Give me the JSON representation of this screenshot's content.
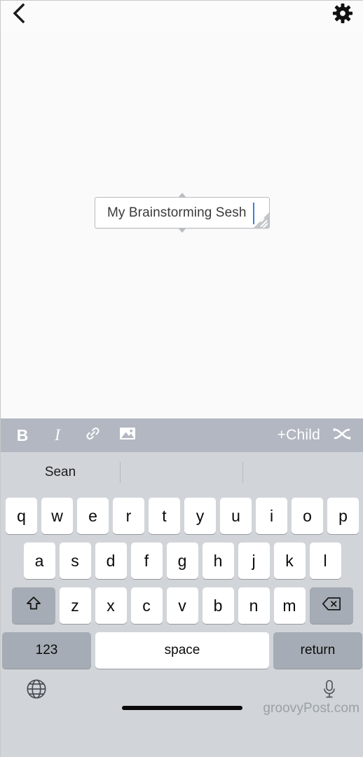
{
  "topbar": {
    "back_icon": "chevron-left-icon",
    "settings_icon": "gear-icon"
  },
  "canvas": {
    "node": {
      "text": "My Brainstorming Sesh",
      "caret_visible": true,
      "resize_handle_icon": "resize-handle-icon",
      "connector_top_icon": "connector-triangle-up-icon",
      "connector_bottom_icon": "connector-triangle-down-icon"
    },
    "background_color": "#fafafa"
  },
  "format_toolbar": {
    "background_color": "#b2b7c1",
    "bold_label": "B",
    "italic_label": "I",
    "link_icon": "link-icon",
    "image_icon": "image-icon",
    "add_child_label": "+Child",
    "sibling_icon": "shuffle-icon"
  },
  "keyboard": {
    "background_color": "#d1d5d9",
    "predictions": [
      "Sean",
      "",
      ""
    ],
    "row1": [
      "q",
      "w",
      "e",
      "r",
      "t",
      "y",
      "u",
      "i",
      "o",
      "p"
    ],
    "row2": [
      "a",
      "s",
      "d",
      "f",
      "g",
      "h",
      "j",
      "k",
      "l"
    ],
    "row3": [
      "z",
      "x",
      "c",
      "v",
      "b",
      "n",
      "m"
    ],
    "shift_icon": "shift-icon",
    "backspace_icon": "backspace-icon",
    "numbers_label": "123",
    "space_label": "space",
    "return_label": "return",
    "globe_icon": "globe-icon",
    "mic_icon": "microphone-icon"
  },
  "watermark": {
    "text": "groovyPost.com"
  }
}
